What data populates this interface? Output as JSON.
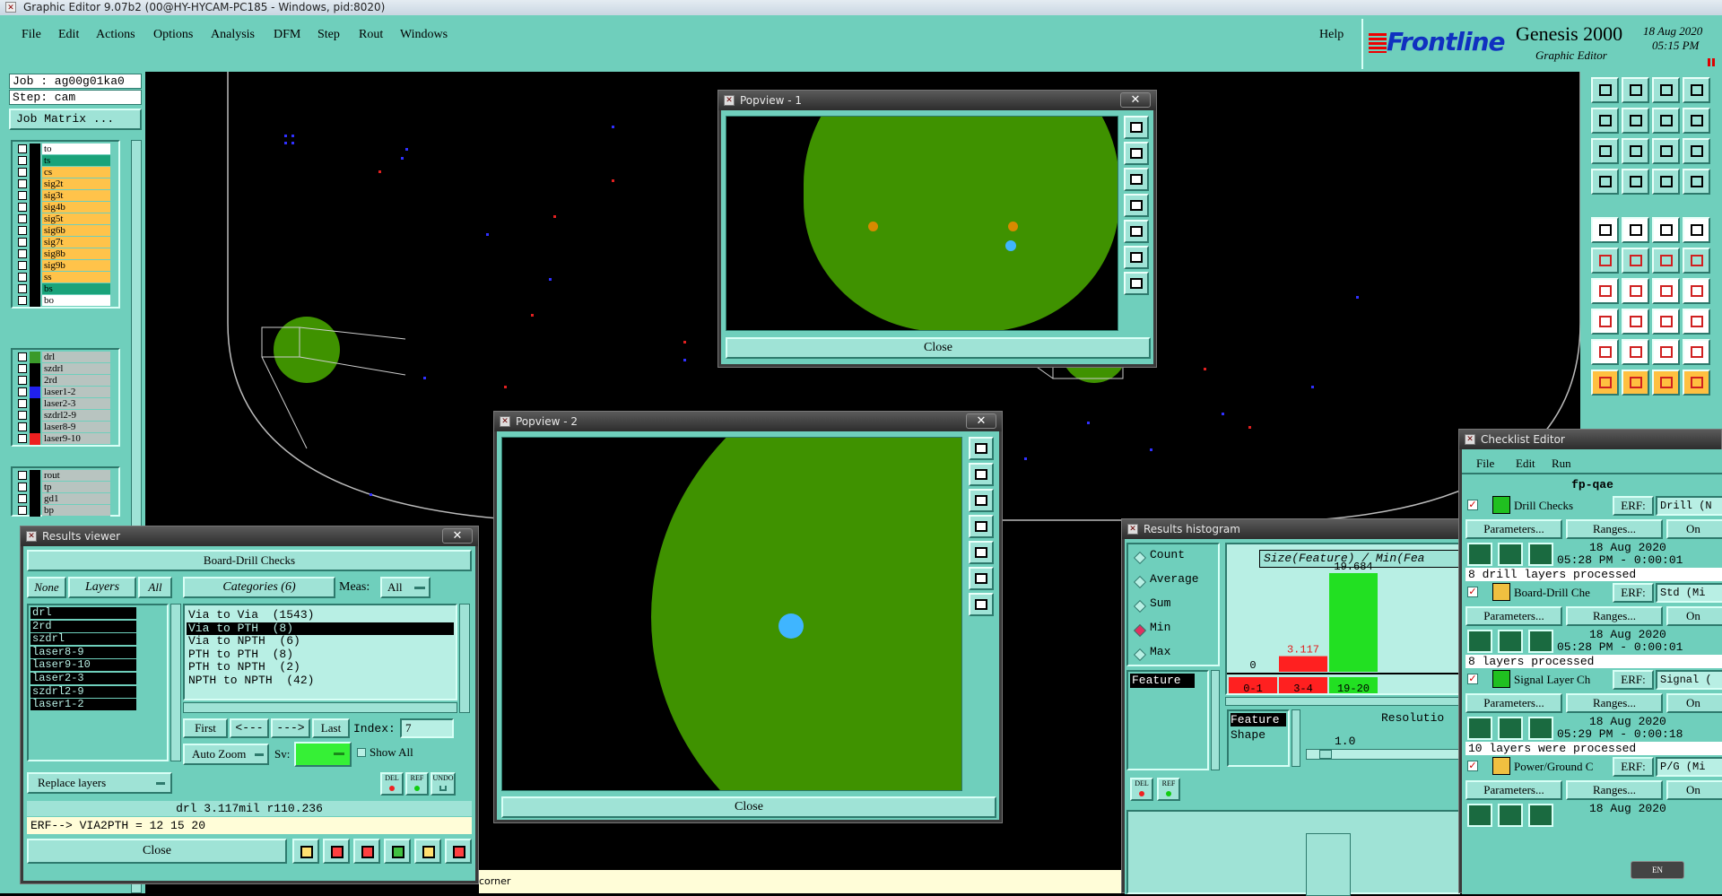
{
  "window": {
    "title": "Graphic Editor 9.07b2 (00@HY-HYCAM-PC185 - Windows, pid:8020)"
  },
  "menu": {
    "items": [
      "File",
      "Edit",
      "Actions",
      "Options",
      "Analysis",
      "DFM",
      "Step",
      "Rout",
      "Windows"
    ],
    "help": "Help"
  },
  "brand": {
    "logo": "Frontline",
    "product": "Genesis 2000",
    "subtitle": "Graphic Editor",
    "date": "18 Aug 2020",
    "time": "05:15 PM"
  },
  "job": {
    "job_label": "Job : ag00g01ka0",
    "step_label": "Step: cam",
    "matrix_button": "Job Matrix ..."
  },
  "layers": {
    "group1": [
      {
        "name": "to",
        "color": "#ffffff"
      },
      {
        "name": "ts",
        "color": "#1aa37a"
      },
      {
        "name": "cs",
        "color": "#ffc34a"
      },
      {
        "name": "sig2t",
        "color": "#ffc34a"
      },
      {
        "name": "sig3t",
        "color": "#ffc34a"
      },
      {
        "name": "sig4b",
        "color": "#ffc34a"
      },
      {
        "name": "sig5t",
        "color": "#ffc34a"
      },
      {
        "name": "sig6b",
        "color": "#ffc34a"
      },
      {
        "name": "sig7t",
        "color": "#ffc34a"
      },
      {
        "name": "sig8b",
        "color": "#ffc34a"
      },
      {
        "name": "sig9b",
        "color": "#ffc34a"
      },
      {
        "name": "ss",
        "color": "#ffc34a"
      },
      {
        "name": "bs",
        "color": "#1aa37a"
      },
      {
        "name": "bo",
        "color": "#ffffff"
      }
    ],
    "group2": [
      {
        "name": "drl",
        "color": "#b8c4c0",
        "swatch": "#3a9a2a"
      },
      {
        "name": "szdrl",
        "color": "#b8c4c0"
      },
      {
        "name": "2rd",
        "color": "#b8c4c0"
      },
      {
        "name": "laser1-2",
        "color": "#b8c4c0",
        "swatch": "#2020ee"
      },
      {
        "name": "laser2-3",
        "color": "#b8c4c0"
      },
      {
        "name": "szdrl2-9",
        "color": "#b8c4c0"
      },
      {
        "name": "laser8-9",
        "color": "#b8c4c0"
      },
      {
        "name": "laser9-10",
        "color": "#b8c4c0",
        "swatch": "#ee2020"
      }
    ],
    "group3": [
      {
        "name": "rout",
        "color": "#b8c4c0"
      },
      {
        "name": "tp",
        "color": "#b8c4c0"
      },
      {
        "name": "gd1",
        "color": "#b8c4c0"
      },
      {
        "name": "bp",
        "color": "#b8c4c0"
      }
    ]
  },
  "popview1": {
    "title": "Popview - 1",
    "close": "Close"
  },
  "popview2": {
    "title": "Popview - 2",
    "close": "Close"
  },
  "results_viewer": {
    "title": "Results viewer",
    "check_name": "Board-Drill Checks",
    "none_btn": "None",
    "layers_btn": "Layers",
    "all_btn": "All",
    "categories_btn": "Categories (6)",
    "meas_label": "Meas:",
    "meas_value": "All",
    "layers": [
      "drl",
      "2rd",
      "szdrl",
      "laser8-9",
      "laser9-10",
      "laser2-3",
      "szdrl2-9",
      "laser1-2"
    ],
    "categories": [
      "Via to Via  (1543)",
      "Via to PTH  (8)",
      "Via to NPTH  (6)",
      "PTH to PTH  (8)",
      "PTH to NPTH  (2)",
      "NPTH to NPTH  (42)"
    ],
    "selected_category": 1,
    "first": "First",
    "prev": "<---",
    "next": "--->",
    "last": "Last",
    "index_label": "Index:",
    "index_value": "7",
    "auto_zoom": "Auto Zoom",
    "sv_label": "Sv:",
    "show_all": "Show All",
    "replace_layers": "Replace layers",
    "del": "DEL",
    "ref": "REF",
    "undo": "UNDO",
    "status": "drl 3.117mil  r110.236",
    "erf": "ERF--> VIA2PTH = 12 15 20",
    "close": "Close",
    "corner": "corner"
  },
  "histogram": {
    "title": "Results histogram",
    "options": [
      "Count",
      "Average",
      "Sum",
      "Min",
      "Max"
    ],
    "selected": "Min",
    "feature_label": "Feature",
    "feature_box": [
      "Feature",
      "Shape"
    ],
    "chart_title": "Size(Feature) / Min(Fea",
    "resolution_label": "Resolutio",
    "resolution_value": "1.0",
    "del": "DEL",
    "ref": "REF"
  },
  "chart_data": {
    "type": "bar",
    "categories": [
      "0-1",
      "3-4",
      "19-20"
    ],
    "values": [
      0,
      3.117,
      19.684
    ],
    "data_labels": [
      "0",
      "3.117",
      "19.684"
    ],
    "colors": [
      "#ff2020",
      "#ff2020",
      "#22e022"
    ],
    "title": "Size(Feature) / Min(Fea"
  },
  "checklist": {
    "title": "Checklist Editor",
    "menu": [
      "File",
      "Edit",
      "Run"
    ],
    "name": "fp-qae",
    "checks": [
      {
        "name": "Drill Checks",
        "erf": "Drill (N",
        "date": "18 Aug 2020",
        "time": "05:28 PM - 0:00:01",
        "status": "8 drill layers processed"
      },
      {
        "name": "Board-Drill Che",
        "erf": "Std (Mi",
        "date": "18 Aug 2020",
        "time": "05:28 PM - 0:00:01",
        "status": "8 layers processed"
      },
      {
        "name": "Signal Layer Ch",
        "erf": "Signal (",
        "date": "18 Aug 2020",
        "time": "05:29 PM - 0:00:18",
        "status": "10 layers were processed"
      },
      {
        "name": "Power/Ground C",
        "erf": "P/G (Mi",
        "date": "18 Aug 2020",
        "time": "",
        "status": ""
      }
    ],
    "erf_label": "ERF:",
    "params": "Parameters...",
    "ranges": "Ranges...",
    "on": "On"
  },
  "tray": {
    "lang": "EN"
  }
}
